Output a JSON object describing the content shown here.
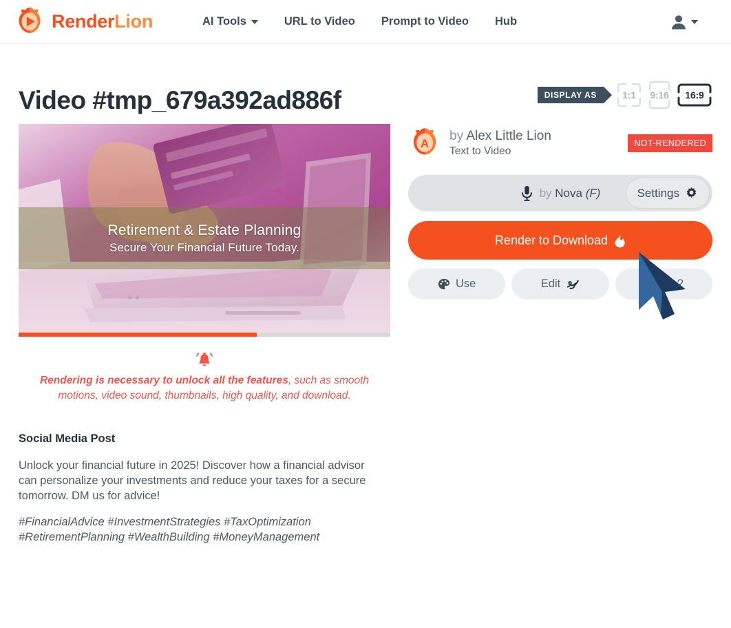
{
  "brand": {
    "name_part1": "Render",
    "name_part2": "Lion",
    "logo_icon": "lion-play-logo",
    "colors": {
      "primary": "#f4511e",
      "secondary": "#ff8b3d"
    }
  },
  "nav": {
    "items": [
      {
        "label": "AI Tools",
        "has_dropdown": true
      },
      {
        "label": "URL to Video",
        "has_dropdown": false
      },
      {
        "label": "Prompt to Video",
        "has_dropdown": false
      },
      {
        "label": "Hub",
        "has_dropdown": false
      }
    ],
    "account_icon": "user-account-icon"
  },
  "header": {
    "title": "Video #tmp_679a392ad886f"
  },
  "display_as": {
    "tag_label": "DISPLAY AS",
    "options": [
      {
        "label": "1:1",
        "active": false
      },
      {
        "label": "9:16",
        "active": false
      },
      {
        "label": "16:9",
        "active": true
      }
    ]
  },
  "video": {
    "overlay_title": "Retirement & Estate Planning",
    "overlay_subtitle": "Secure Your Financial Future Today.",
    "progress_percent": 64
  },
  "warning": {
    "icon": "bell-alert-icon",
    "bold_text": "Rendering is necessary to unlock all the features",
    "rest_text": ", such as smooth motions, video sound, thumbnails, high quality, and download.",
    "color": "#f4554a"
  },
  "social": {
    "heading": "Social Media Post",
    "body": "Unlock your financial future in 2025! Discover how a financial advisor can personalize your investments and reduce your taxes for a secure tomorrow. DM us for advice!",
    "hashtags": "#FinancialAdvice #InvestmentStrategies #TaxOptimization #RetirementPlanning #WealthBuilding #MoneyManagement"
  },
  "author": {
    "avatar_icon": "lion-avatar-a",
    "by_label": "by",
    "name": "Alex Little Lion",
    "kind": "Text to Video",
    "status": "NOT-RENDERED",
    "status_color": "#f4483d"
  },
  "voice": {
    "mic_icon": "microphone-icon",
    "by_label": "by",
    "name": "Nova",
    "gender": "(F)",
    "settings_label": "Settings",
    "settings_icon": "gear-icon"
  },
  "actions": {
    "render_label": "Render to Download",
    "render_icon": "flame-icon",
    "use_label": "Use",
    "use_icon": "palette-icon",
    "edit_label": "Edit",
    "edit_icon": "scribble-pen-icon",
    "delete_label": "Delete?"
  },
  "cursor": {
    "icon": "mouse-arrow-cursor"
  }
}
